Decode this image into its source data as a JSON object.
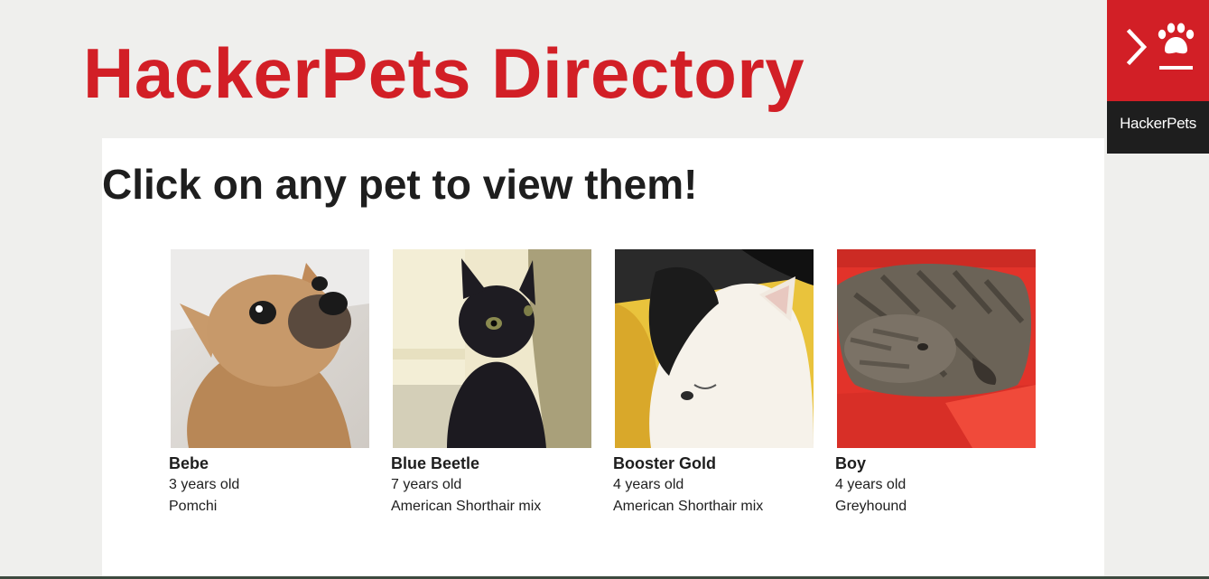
{
  "header": {
    "site_title": "HackerPets Directory"
  },
  "main": {
    "subtitle": "Click on any pet to view them!",
    "pets": [
      {
        "name": "Bebe",
        "age": "3 years old",
        "breed": "Pomchi"
      },
      {
        "name": "Blue Beetle",
        "age": "7 years old",
        "breed": "American Shorthair mix"
      },
      {
        "name": "Booster Gold",
        "age": "4 years old",
        "breed": "American Shorthair mix"
      },
      {
        "name": "Boy",
        "age": "4 years old",
        "breed": "Greyhound"
      }
    ]
  },
  "badge": {
    "label": "HackerPets",
    "icon": "terminal-paw-icon"
  },
  "colors": {
    "brand_red": "#d21f26",
    "text_dark": "#1e1e1e",
    "page_bg": "#efefed",
    "panel_bg": "#ffffff"
  }
}
